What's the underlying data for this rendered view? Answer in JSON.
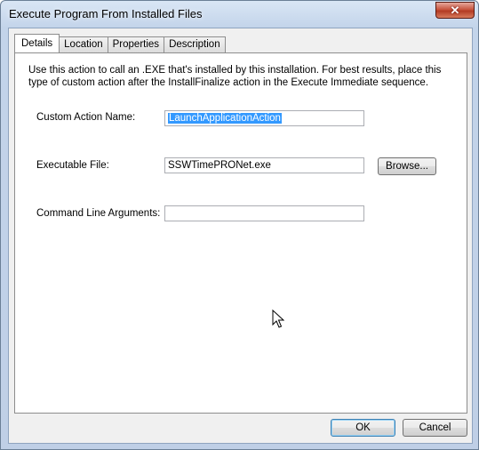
{
  "window": {
    "title": "Execute Program From Installed Files",
    "close_glyph": "✕"
  },
  "tabs": [
    {
      "label": "Details",
      "active": true
    },
    {
      "label": "Location"
    },
    {
      "label": "Properties"
    },
    {
      "label": "Description"
    }
  ],
  "details": {
    "description": "Use this action to call an .EXE that's installed by this installation. For best results, place this type of custom action after the InstallFinalize action in the Execute Immediate sequence.",
    "custom_action_name_label": "Custom Action Name:",
    "custom_action_name_value": "LaunchApplicationAction",
    "executable_file_label": "Executable File:",
    "executable_file_value": "SSWTimePRONet.exe",
    "browse_label": "Browse...",
    "command_line_label": "Command Line Arguments:",
    "command_line_value": ""
  },
  "footer": {
    "ok_label": "OK",
    "cancel_label": "Cancel"
  },
  "colors": {
    "selection": "#3399ff",
    "close_button": "#c8553f",
    "default_button_border": "#3c7fb1"
  }
}
